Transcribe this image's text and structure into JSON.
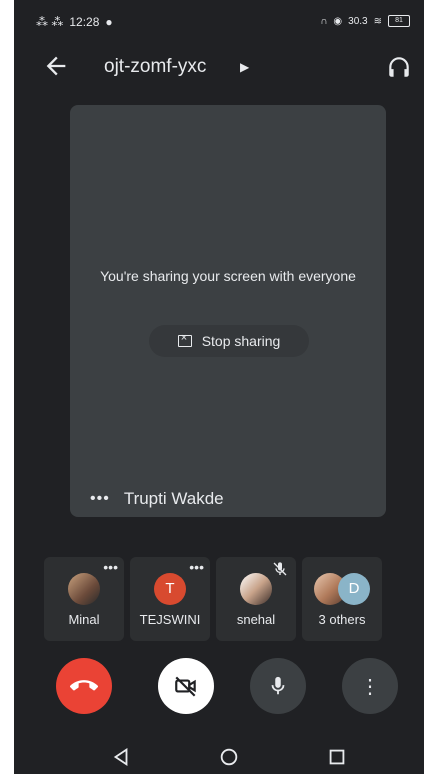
{
  "status_bar": {
    "left_icons": "⁂ ⁂",
    "time": "12:28",
    "network_speed": "30.3",
    "battery": "81"
  },
  "header": {
    "meeting_code": "ojt-zomf-yxc"
  },
  "main_tile": {
    "message": "You're sharing your screen with everyone",
    "stop_sharing_label": "Stop sharing",
    "presenter_name": "Trupti Wakde"
  },
  "participants": [
    {
      "name": "Minal"
    },
    {
      "name": "TEJSWINI",
      "initial": "T"
    },
    {
      "name": "snehal"
    },
    {
      "name": "3 others",
      "initial": "D"
    }
  ],
  "colors": {
    "background": "#202124",
    "tile": "#3c4043",
    "end_call": "#ea4335",
    "avatar_t": "#d84a2f"
  }
}
